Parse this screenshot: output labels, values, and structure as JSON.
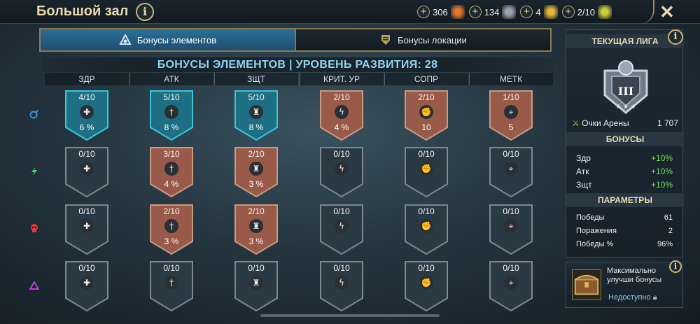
{
  "header": {
    "title": "Большой зал",
    "resources": [
      {
        "value": "306",
        "icon": "orange-rank-icon",
        "color": "#e07a2c"
      },
      {
        "value": "134",
        "icon": "silver-rank-icon",
        "color": "#9aa6b4"
      },
      {
        "value": "4",
        "icon": "gold-rank-icon",
        "color": "#e6b83a"
      },
      {
        "value": "2/10",
        "icon": "gold-coin-icon",
        "color": "#c9cf3a"
      }
    ]
  },
  "tabs": [
    {
      "label": "Бонусы элементов",
      "active": true
    },
    {
      "label": "Бонусы локации",
      "active": false
    }
  ],
  "heading": "БОНУСЫ ЭЛЕМЕНТОВ | УРОВЕНЬ РАЗВИТИЯ: 28",
  "columns": [
    "ЗДР",
    "АТК",
    "ЗЩТ",
    "КРИТ. УР",
    "СОПР",
    "МЕТК"
  ],
  "rows": [
    {
      "affinity": "magic",
      "icon_color": "#3d8ee8",
      "cells": [
        {
          "level": "4/10",
          "value": "6 %",
          "state": "blue"
        },
        {
          "level": "5/10",
          "value": "8 %",
          "state": "blue"
        },
        {
          "level": "5/10",
          "value": "8 %",
          "state": "blue"
        },
        {
          "level": "2/10",
          "value": "4 %",
          "state": "copper"
        },
        {
          "level": "2/10",
          "value": "10",
          "state": "copper"
        },
        {
          "level": "1/10",
          "value": "5",
          "state": "copper"
        }
      ]
    },
    {
      "affinity": "spirit",
      "icon_color": "#3fd65a",
      "cells": [
        {
          "level": "0/10",
          "value": "",
          "state": "dark"
        },
        {
          "level": "3/10",
          "value": "4 %",
          "state": "copper"
        },
        {
          "level": "2/10",
          "value": "3 %",
          "state": "copper"
        },
        {
          "level": "0/10",
          "value": "",
          "state": "dark"
        },
        {
          "level": "0/10",
          "value": "",
          "state": "dark"
        },
        {
          "level": "0/10",
          "value": "",
          "state": "dark"
        }
      ]
    },
    {
      "affinity": "force",
      "icon_color": "#e03a3a",
      "cells": [
        {
          "level": "0/10",
          "value": "",
          "state": "dark"
        },
        {
          "level": "2/10",
          "value": "3 %",
          "state": "copper"
        },
        {
          "level": "2/10",
          "value": "3 %",
          "state": "copper"
        },
        {
          "level": "0/10",
          "value": "",
          "state": "dark"
        },
        {
          "level": "0/10",
          "value": "",
          "state": "dark"
        },
        {
          "level": "0/10",
          "value": "",
          "state": "dark"
        }
      ]
    },
    {
      "affinity": "void",
      "icon_color": "#c03fd6",
      "cells": [
        {
          "level": "0/10",
          "value": "",
          "state": "dark"
        },
        {
          "level": "0/10",
          "value": "",
          "state": "dark"
        },
        {
          "level": "0/10",
          "value": "",
          "state": "dark"
        },
        {
          "level": "0/10",
          "value": "",
          "state": "dark"
        },
        {
          "level": "0/10",
          "value": "",
          "state": "dark"
        },
        {
          "level": "0/10",
          "value": "",
          "state": "dark"
        }
      ]
    }
  ],
  "column_icons": [
    "✚",
    "†",
    "♜",
    "ϟ",
    "✊",
    "⌖"
  ],
  "league": {
    "title": "ТЕКУЩАЯ ЛИГА",
    "emblem_numeral": "III",
    "arena_points_label": "Очки Арены",
    "arena_points_value": "1 707",
    "bonuses_title": "БОНУСЫ",
    "bonuses": [
      {
        "label": "Здр",
        "value": "+10%"
      },
      {
        "label": "Атк",
        "value": "+10%"
      },
      {
        "label": "Зщт",
        "value": "+10%"
      }
    ],
    "params_title": "ПАРАМЕТРЫ",
    "params": [
      {
        "label": "Победы",
        "value": "61"
      },
      {
        "label": "Поражения",
        "value": "2"
      },
      {
        "label": "Победы %",
        "value": "96%"
      }
    ]
  },
  "upgrade": {
    "text": "Максимально улучши бонусы",
    "status": "Недоступно"
  },
  "colors": {
    "blue_badge": "#1f6f84",
    "blue_border": "#39c6dc",
    "copper_badge": "#9a5a4a",
    "copper_border": "#c79a82",
    "dark_badge": "#2a3a44",
    "dark_border": "#7c8790"
  }
}
